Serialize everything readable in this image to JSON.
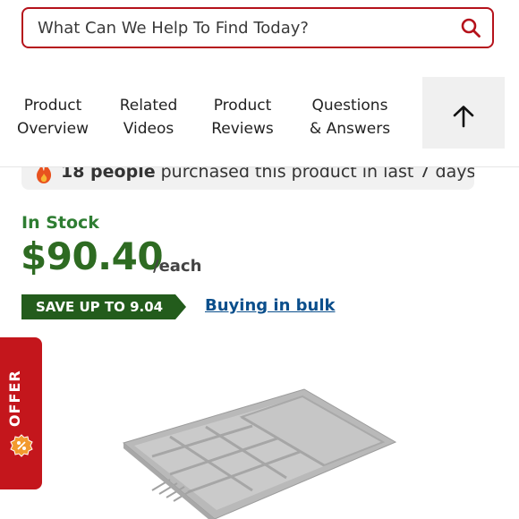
{
  "search": {
    "placeholder": "What Can We Help To Find Today?"
  },
  "tabs": [
    {
      "line1": "Product",
      "line2": "Overview"
    },
    {
      "line1": "Related",
      "line2": "Videos"
    },
    {
      "line1": "Product",
      "line2": "Reviews"
    },
    {
      "line1": "Questions",
      "line2": "& Answers"
    }
  ],
  "purchase_banner": {
    "count_text": "18 people",
    "rest_text": "purchased this product in last 7 days"
  },
  "stock_status": "In Stock",
  "price": {
    "amount": "$90.40",
    "unit": "/each"
  },
  "save_tag": "SAVE UP TO 9.04",
  "bulk_link": "Buying in bulk",
  "offer_tab": "OFFER",
  "colors": {
    "brand_red": "#b5121b",
    "stock_green": "#2e7d32",
    "price_green": "#2e6b22",
    "tag_green": "#235c1c",
    "link_blue": "#0b4f8c"
  }
}
